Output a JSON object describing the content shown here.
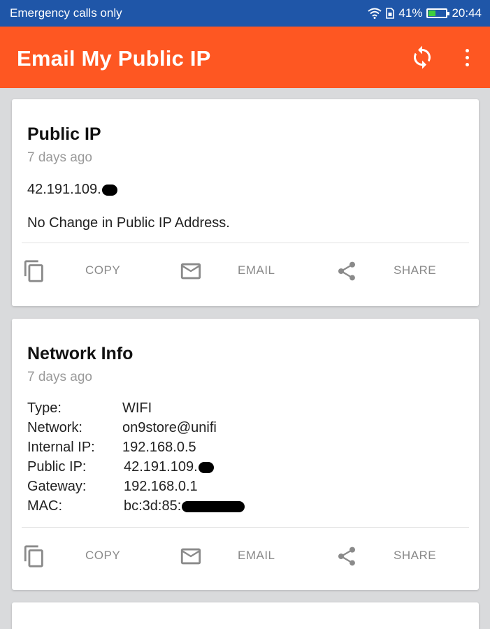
{
  "status_bar": {
    "left_text": "Emergency calls only",
    "battery": "41%",
    "time": "20:44",
    "icons": [
      "wifi-icon",
      "sim-icon",
      "battery-icon"
    ]
  },
  "app_bar": {
    "title": "Email My Public IP",
    "icons": [
      "refresh-icon",
      "more-vert-icon"
    ],
    "color": "#fe5722"
  },
  "cards": [
    {
      "title": "Public IP",
      "subtitle": "7 days ago",
      "ip": "42.191.109.",
      "message": "No Change in Public IP Address.",
      "actions": [
        {
          "icon": "copy-icon",
          "label": "COPY"
        },
        {
          "icon": "email-icon",
          "label": "EMAIL"
        },
        {
          "icon": "share-icon",
          "label": "SHARE"
        }
      ]
    },
    {
      "title": "Network Info",
      "subtitle": "7 days ago",
      "rows": [
        {
          "label": "Type:",
          "value": "WIFI"
        },
        {
          "label": "Network:",
          "value": "on9store@unifi"
        },
        {
          "label": "Internal IP:",
          "value": "192.168.0.5"
        },
        {
          "label": "Public IP:",
          "value": "42.191.109."
        },
        {
          "label": "Gateway:",
          "value": "192.168.0.1"
        },
        {
          "label": "MAC:",
          "value": "bc:3d:85:"
        }
      ],
      "actions": [
        {
          "icon": "copy-icon",
          "label": "COPY"
        },
        {
          "icon": "email-icon",
          "label": "EMAIL"
        },
        {
          "icon": "share-icon",
          "label": "SHARE"
        }
      ]
    }
  ],
  "colors": {
    "status_bar": "#1f56a8",
    "app_bar": "#fe5722",
    "background": "#d9dadc"
  }
}
